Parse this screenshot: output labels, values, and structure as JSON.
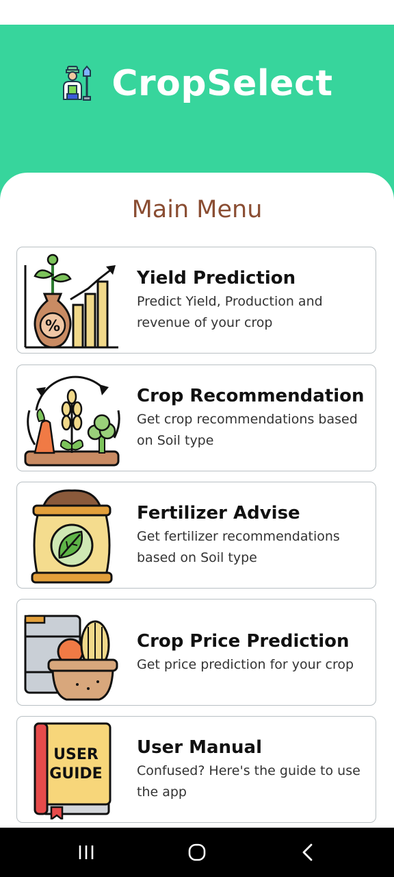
{
  "app": {
    "name": "CropSelect",
    "logo_icon": "farmer-icon"
  },
  "menu": {
    "title": "Main Menu",
    "items": [
      {
        "title": "Yield Prediction",
        "description": "Predict Yield, Production and revenue of your crop",
        "icon": "yield-growth-icon"
      },
      {
        "title": "Crop Recommendation",
        "description": "Get crop recommendations based on Soil type",
        "icon": "crop-cycle-icon"
      },
      {
        "title": "Fertilizer Advise",
        "description": "Get fertilizer recommendations based on Soil type",
        "icon": "fertilizer-bag-icon"
      },
      {
        "title": "Crop Price Prediction",
        "description": "Get price prediction for your crop",
        "icon": "crop-basket-icon"
      },
      {
        "title": "User Manual",
        "description": "Confused? Here's the guide to use the app",
        "icon": "user-guide-book-icon"
      }
    ],
    "guide_book_text": [
      "USER",
      "GUIDE"
    ]
  },
  "navigation": {
    "buttons": [
      "recents-button",
      "home-button",
      "back-button"
    ]
  },
  "colors": {
    "header": "#37d59c",
    "menu_title": "#8a4d32",
    "card_border": "#b9c0c4",
    "nav_bar": "#000000"
  }
}
